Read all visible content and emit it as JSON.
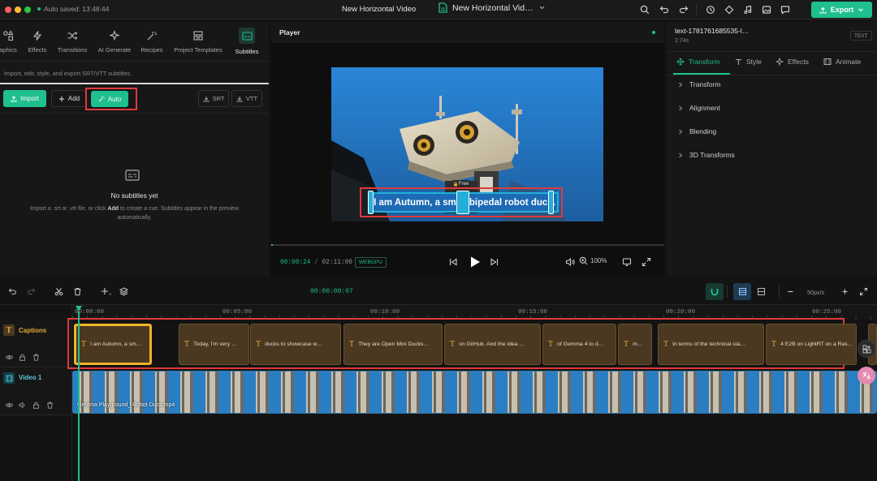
{
  "topbar": {
    "autosave": "Auto saved: 13:48:44",
    "project_name": "New Horizontal Video",
    "file_name": "New Horizontal Vid…",
    "export_label": "Export"
  },
  "colors": {
    "accent": "#1fbf8f",
    "highlight": "#e03a3a",
    "clip_selected": "#f0b429"
  },
  "left_panel": {
    "tabs": [
      {
        "label": "aphics",
        "icon": "graphics-icon"
      },
      {
        "label": "Effects",
        "icon": "lightning-icon"
      },
      {
        "label": "Transitions",
        "icon": "shuffle-icon"
      },
      {
        "label": "AI Generate",
        "icon": "sparkle-icon"
      },
      {
        "label": "Recipes",
        "icon": "wand-icon"
      },
      {
        "label": "Project Templates",
        "icon": "layout-icon"
      },
      {
        "label": "Subtitles",
        "icon": "subtitles-icon",
        "active": true
      }
    ],
    "description": "Import, edit, style, and export SRT/VTT subtitles.",
    "import_label": "Import",
    "add_label": "Add",
    "auto_label": "Auto",
    "srt_label": "SRT",
    "vtt_label": "VTT",
    "empty_title": "No subtitles yet",
    "empty_text_1": "Import a .srt or .vtt file, or click ",
    "empty_text_bold": "Add",
    "empty_text_2": " to create a cue. Subtitles appear in the preview",
    "empty_text_3": "automatically."
  },
  "player": {
    "title": "Player",
    "subtitle_text": "I am Autumn, a small bipedal robot duck.",
    "lock_label": "Free",
    "current_time": "00:00:24",
    "total_time": "02:11:00",
    "backend_badge": "WEBGPU",
    "zoom": "100%"
  },
  "right_panel": {
    "element_name": "text-1781761685535-l…",
    "duration": "2.74s",
    "type_badge": "TEXT",
    "tabs": [
      {
        "label": "Transform",
        "active": true
      },
      {
        "label": "Style"
      },
      {
        "label": "Effects"
      },
      {
        "label": "Animate"
      }
    ],
    "sections": [
      "Transform",
      "Alignment",
      "Blending",
      "3D Transforms"
    ]
  },
  "timeline": {
    "playhead_time": "00:00:00:07",
    "zoom_label": "50px/s",
    "ruler": [
      "00:00:00",
      "00:05:00",
      "00:10:00",
      "00:15:00",
      "00:20:00",
      "00:25:00"
    ],
    "tracks": [
      {
        "name": "Captions"
      },
      {
        "name": "Video 1"
      }
    ],
    "caption_clips": [
      "I am Autumn, a sm…",
      "Today, I'm very …",
      "ducks to showcase w…",
      "They are Open Mini Ducks…",
      "on GitHub. And the idea …",
      "of Gemma 4 to d…",
      "m…",
      "In terms of the technical sta…",
      "4 E2B on LightRT on a Ras…"
    ],
    "video_clip_name": "Gemma Playground_ Robot Duck.mp4"
  }
}
